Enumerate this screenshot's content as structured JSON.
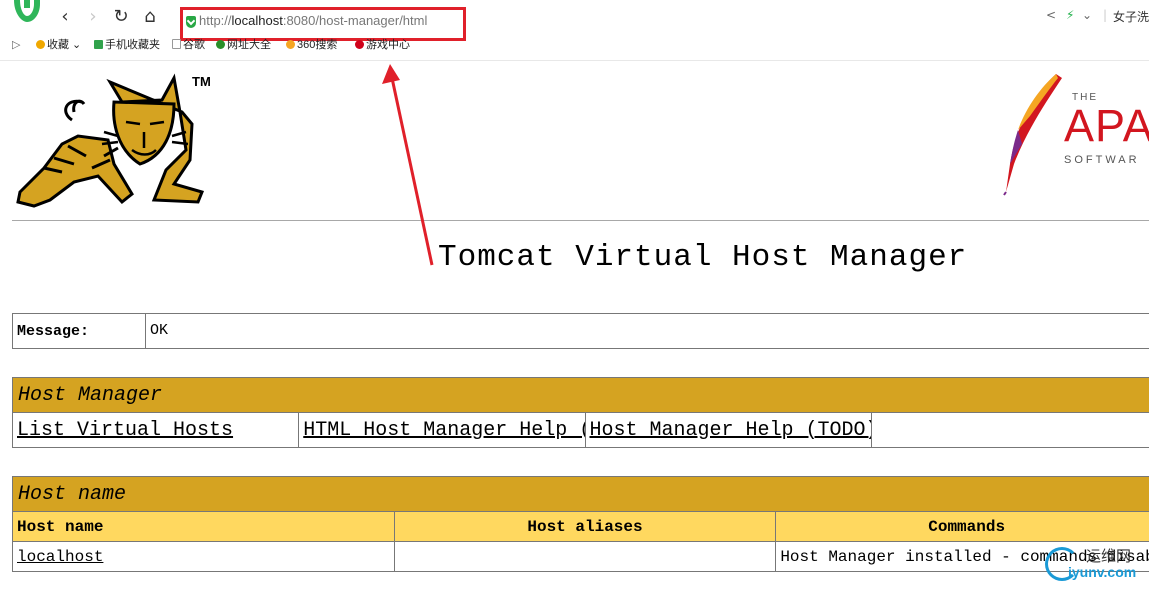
{
  "browser": {
    "address_scheme": "http://",
    "address_host": "localhost",
    "address_path": ":8080/host-manager/html",
    "right_search_text": "女子洗",
    "bookmarks": [
      {
        "label": "收藏",
        "color": "#f0a800"
      },
      {
        "label": "手机收藏夹",
        "color": "#31a24c"
      },
      {
        "label": "谷歌",
        "color": "#999999"
      },
      {
        "label": "网址大全",
        "color": "#2a8f2a"
      },
      {
        "label": "360搜索",
        "color": "#f5a623"
      },
      {
        "label": "游戏中心",
        "color": "#d0021b"
      }
    ]
  },
  "header": {
    "tomcat_tm": "TM",
    "apache_the": "THE",
    "apache_word": "APA",
    "apache_software": "SOFTWAR"
  },
  "page": {
    "title": "Tomcat Virtual Host Manager"
  },
  "message": {
    "label": "Message:",
    "value": "OK"
  },
  "host_manager_section": {
    "title": "Host Manager",
    "links": [
      "List Virtual Hosts",
      "HTML Host Manager Help (TODO)",
      "Host Manager Help (TODO)"
    ]
  },
  "host_name_section": {
    "title": "Host name",
    "columns": [
      "Host name",
      "Host aliases",
      "Commands"
    ],
    "rows": [
      {
        "host_name": "localhost",
        "host_aliases": "",
        "commands": "Host Manager installed - commands disabled"
      }
    ]
  },
  "watermark": {
    "top": "运维网",
    "bottom": "iyunv.com"
  },
  "colors": {
    "section_bar": "#d5a321",
    "column_header": "#ffd85f",
    "annotation_red": "#e0202a",
    "apache_red": "#d2161f"
  }
}
